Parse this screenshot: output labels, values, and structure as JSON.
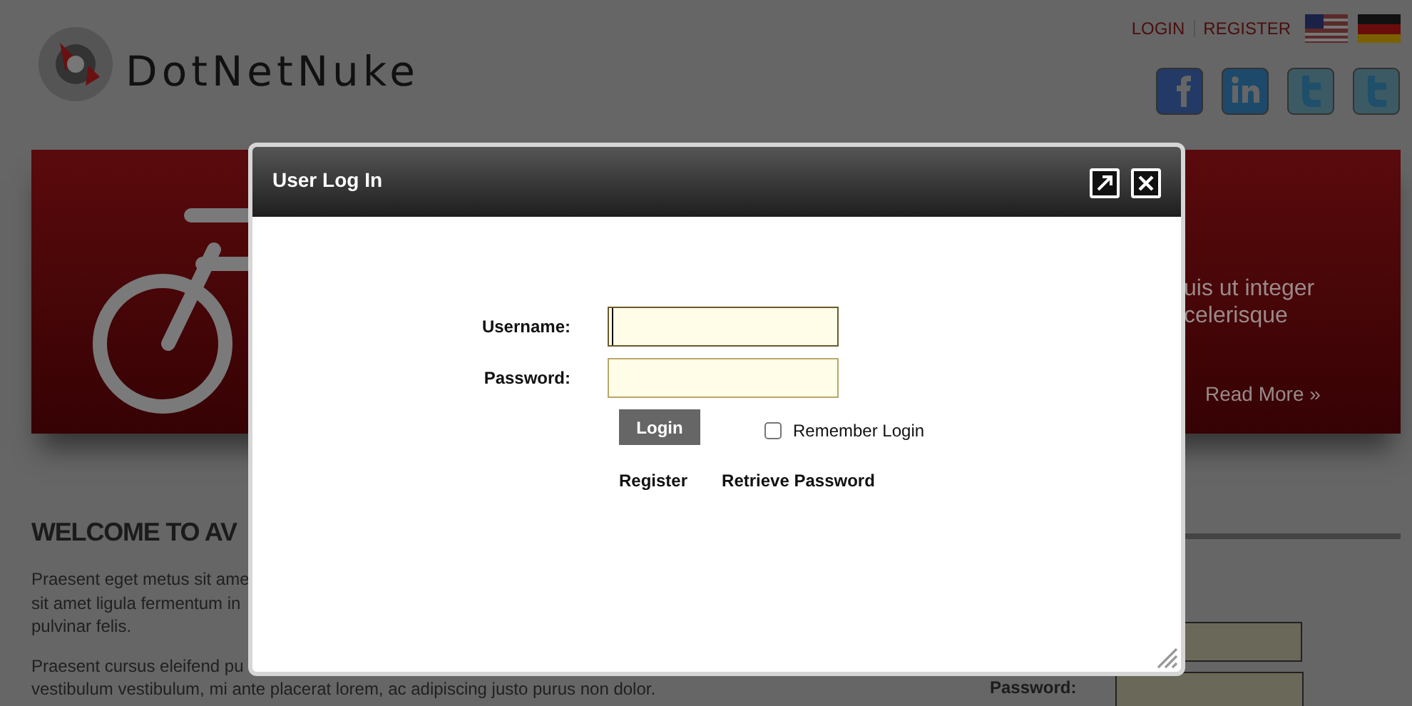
{
  "header": {
    "logo_text": "DotNetNuke",
    "links": [
      {
        "label": "LOGIN"
      },
      {
        "label": "REGISTER"
      }
    ],
    "languages": [
      {
        "kind": "us"
      },
      {
        "kind": "de"
      }
    ],
    "social": [
      {
        "kind": "facebook"
      },
      {
        "kind": "linkedin"
      },
      {
        "kind": "twitter"
      },
      {
        "kind": "twitter"
      }
    ]
  },
  "banner": {
    "lines": [
      "uis ut integer",
      "celerisque"
    ],
    "link": "Read More »"
  },
  "content": {
    "heading": "WELCOME TO AV",
    "lines": [
      "Praesent eget metus sit ame",
      "sit amet ligula fermentum in",
      "pulvinar felis."
    ],
    "lines_2": [
      "Praesent cursus eleifend pu",
      "vestibulum vestibulum, mi ante placerat lorem, ac adipiscing justo purus non dolor."
    ]
  },
  "sidebar_login": {
    "password_label": "Password:"
  },
  "dialog": {
    "title": "User Log In",
    "fields": [
      {
        "label": "Username:",
        "focused": true
      },
      {
        "label": "Password:",
        "focused": false
      }
    ],
    "login_button": "Login",
    "remember": {
      "label": "Remember Login",
      "checked": false
    },
    "links": [
      "Register",
      "Retrieve Password"
    ]
  }
}
